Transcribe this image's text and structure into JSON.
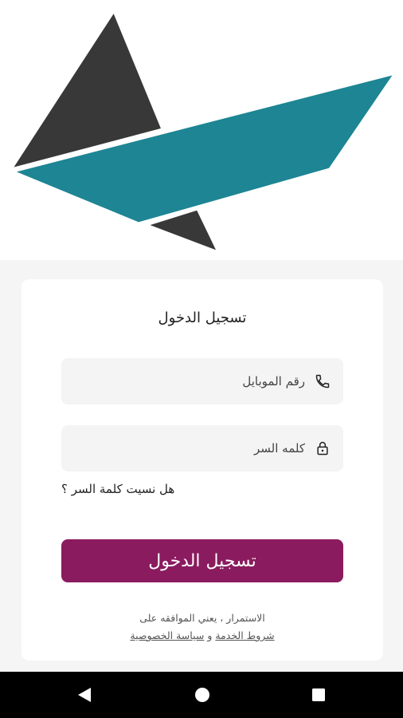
{
  "login": {
    "title": "تسجيل الدخول",
    "phone_placeholder": "رقم الموبايل",
    "password_placeholder": "كلمه السر",
    "forgot_password": "هل نسيت كلمة السر ؟",
    "submit_label": "تسجيل الدخول",
    "consent_text": "الاستمرار ، يعني الموافقه على",
    "terms_link": "شروط الخدمة",
    "and_word": "و",
    "privacy_link": "سياسة الخصوصية"
  },
  "colors": {
    "logo_dark": "#383838",
    "logo_teal": "#1d8593",
    "primary_button": "#8a1b5e",
    "navbar": "#000000"
  },
  "icons": {
    "phone": "phone-icon",
    "password": "lock-icon",
    "nav_back": "back-triangle-icon",
    "nav_home": "home-circle-icon",
    "nav_recents": "recents-square-icon"
  }
}
